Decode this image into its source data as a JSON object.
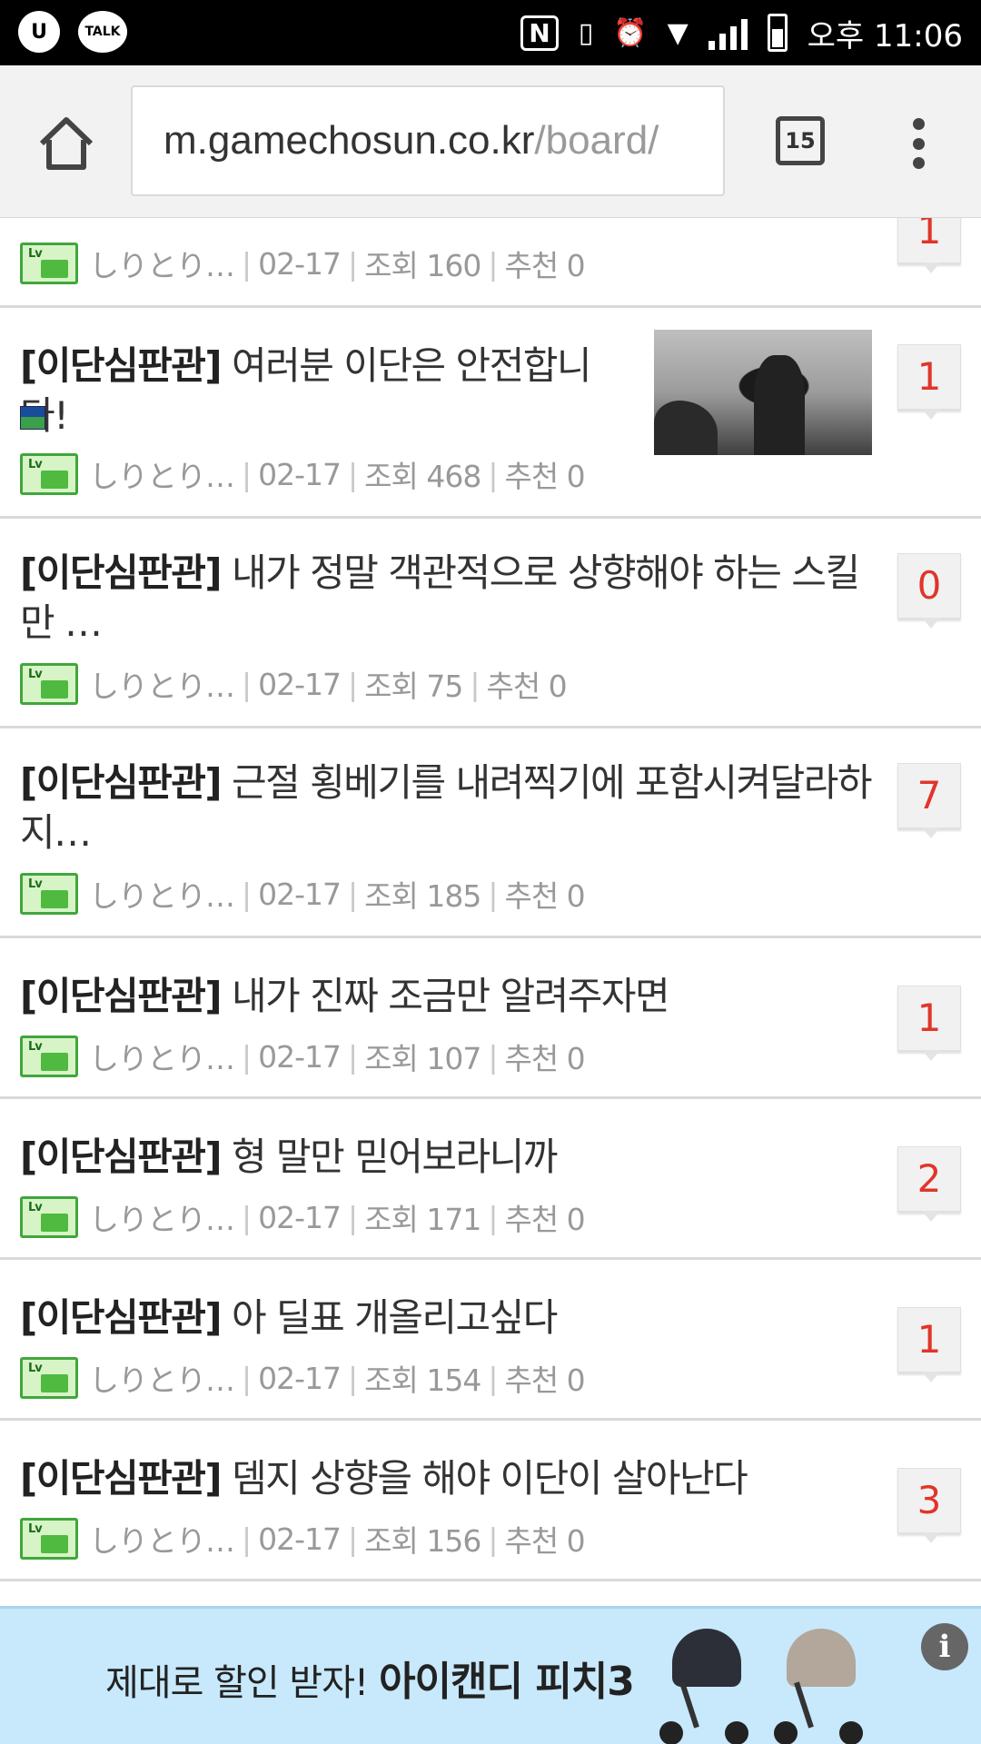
{
  "status_bar": {
    "app_icon_u": "U",
    "app_icon_talk": "TALK",
    "nfc": "N",
    "alarm": "⏰",
    "ampm": "오후",
    "time": "11:06"
  },
  "browser": {
    "url_host": "m.gamechosun.co.kr",
    "url_path": "/board/",
    "tab_count": "15"
  },
  "posts": [
    {
      "category": "",
      "title": "",
      "author": "しりとり…",
      "date": "02-17",
      "views": "조회 160",
      "recommend": "추천 0",
      "comments": "1"
    },
    {
      "category": "[이단심판관]",
      "title": " 여러분 이단은 안전합니다!",
      "author": "しりとり…",
      "date": "02-17",
      "views": "조회 468",
      "recommend": "추천 0",
      "comments": "1"
    },
    {
      "category": "[이단심판관]",
      "title": " 내가 정말 객관적으로 상향해야 하는 스킬만 …",
      "author": "しりとり…",
      "date": "02-17",
      "views": "조회 75",
      "recommend": "추천 0",
      "comments": "0"
    },
    {
      "category": "[이단심판관]",
      "title": " 근절 횡베기를 내려찍기에 포함시켜달라하지…",
      "author": "しりとり…",
      "date": "02-17",
      "views": "조회 185",
      "recommend": "추천 0",
      "comments": "7"
    },
    {
      "category": "[이단심판관]",
      "title": " 내가 진짜 조금만 알려주자면",
      "author": "しりとり…",
      "date": "02-17",
      "views": "조회 107",
      "recommend": "추천 0",
      "comments": "1"
    },
    {
      "category": "[이단심판관]",
      "title": " 형 말만 믿어보라니까",
      "author": "しりとり…",
      "date": "02-17",
      "views": "조회 171",
      "recommend": "추천 0",
      "comments": "2"
    },
    {
      "category": "[이단심판관]",
      "title": " 아 딜표 개올리고싶다",
      "author": "しりとり…",
      "date": "02-17",
      "views": "조회 154",
      "recommend": "추천 0",
      "comments": "1"
    },
    {
      "category": "[이단심판관]",
      "title": " 뎀지 상향을 해야 이단이 살아난다",
      "author": "しりとり…",
      "date": "02-17",
      "views": "조회 156",
      "recommend": "추천 0",
      "comments": "3"
    }
  ],
  "ad": {
    "text": "제대로 할인 받자!",
    "product": "아이캔디 피치3",
    "info": "i"
  }
}
